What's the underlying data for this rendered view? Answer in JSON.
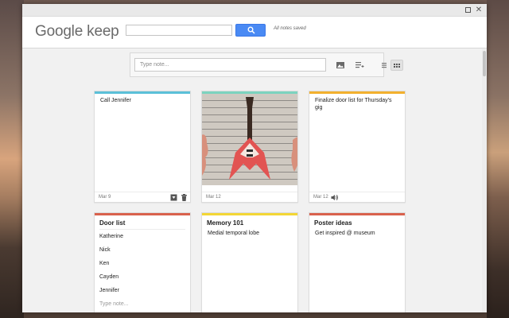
{
  "app": {
    "logo": "Google keep",
    "saved_status": "All notes saved"
  },
  "toolbar": {
    "note_placeholder": "Type note...",
    "icons": [
      "image-icon",
      "list-add-icon",
      "list-view-icon",
      "grid-view-icon"
    ]
  },
  "colors": {
    "accent": "#4a8af4",
    "note_cyan": "#5bc0d8",
    "note_teal": "#7cd3bf",
    "note_orange": "#f2b02e",
    "note_red": "#d9614d",
    "note_yellow": "#f3d635",
    "note_coral": "#d9614d"
  },
  "notes": [
    {
      "text": "Call Jennifer",
      "date": "Mar 9",
      "icons": [
        "archive-icon",
        "trash-icon"
      ]
    },
    {
      "image": "guitar-image",
      "date": "Mar 12"
    },
    {
      "text": "Finalize door list for Thursday's gig",
      "date": "Mar 12",
      "icons": [
        "speaker-icon"
      ]
    },
    {
      "title": "Door list",
      "items": [
        "Katherine",
        "Nick",
        "Ken",
        "Cayden",
        "Jennifer"
      ],
      "item_placeholder": "Type note..."
    },
    {
      "title": "Memory 101",
      "text": "Medial temporal lobe"
    },
    {
      "title": "Poster ideas",
      "text": "Get inspired @ museum"
    }
  ]
}
